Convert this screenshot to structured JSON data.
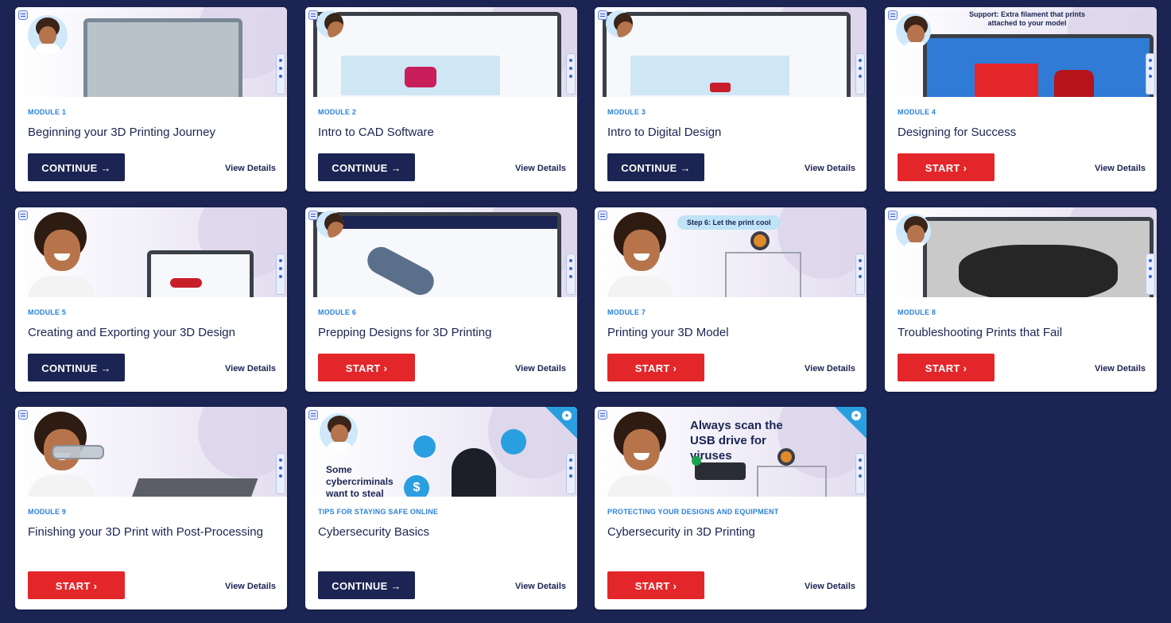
{
  "colors": {
    "background": "#1b2452",
    "continue": "#1b2452",
    "start": "#e3262a",
    "module_label": "#2b82d9"
  },
  "cards": [
    {
      "module": "MODULE 1",
      "title": "Beginning your 3D Printing Journey",
      "button": "CONTINUE →",
      "status": "continue",
      "details": "View Details"
    },
    {
      "module": "MODULE 2",
      "title": "Intro to CAD Software",
      "button": "CONTINUE →",
      "status": "continue",
      "details": "View Details"
    },
    {
      "module": "MODULE 3",
      "title": "Intro to Digital Design",
      "button": "CONTINUE →",
      "status": "continue",
      "details": "View Details"
    },
    {
      "module": "MODULE 4",
      "title": "Designing for Success",
      "button": "START ›",
      "status": "start",
      "details": "View Details",
      "thumb_text": "Support: Extra filament that prints attached to your model"
    },
    {
      "module": "MODULE 5",
      "title": "Creating and Exporting your 3D Design",
      "button": "CONTINUE →",
      "status": "continue",
      "details": "View Details"
    },
    {
      "module": "MODULE 6",
      "title": "Prepping Designs for 3D Printing",
      "button": "START ›",
      "status": "start",
      "details": "View Details"
    },
    {
      "module": "MODULE 7",
      "title": "Printing your 3D Model",
      "button": "START ›",
      "status": "start",
      "details": "View Details",
      "thumb_text": "Step 6: Let the print cool"
    },
    {
      "module": "MODULE 8",
      "title": "Troubleshooting Prints that Fail",
      "button": "START ›",
      "status": "start",
      "details": "View Details"
    },
    {
      "module": "MODULE 9",
      "title": "Finishing your 3D Print with Post-Processing",
      "button": "START ›",
      "status": "start",
      "details": "View Details"
    },
    {
      "module": "TIPS FOR STAYING SAFE ONLINE",
      "title": "Cybersecurity Basics",
      "button": "CONTINUE →",
      "status": "continue",
      "details": "View Details",
      "thumb_text": "Some cybercriminals want to steal"
    },
    {
      "module": "PROTECTING YOUR DESIGNS AND EQUIPMENT",
      "title": "Cybersecurity in 3D Printing",
      "button": "START ›",
      "status": "start",
      "details": "View Details",
      "thumb_text": "Always scan the USB drive for viruses"
    }
  ],
  "icons": {
    "menu": "menu-icon",
    "lock": "lock-icon",
    "side_controls": "side-controls-icon"
  }
}
